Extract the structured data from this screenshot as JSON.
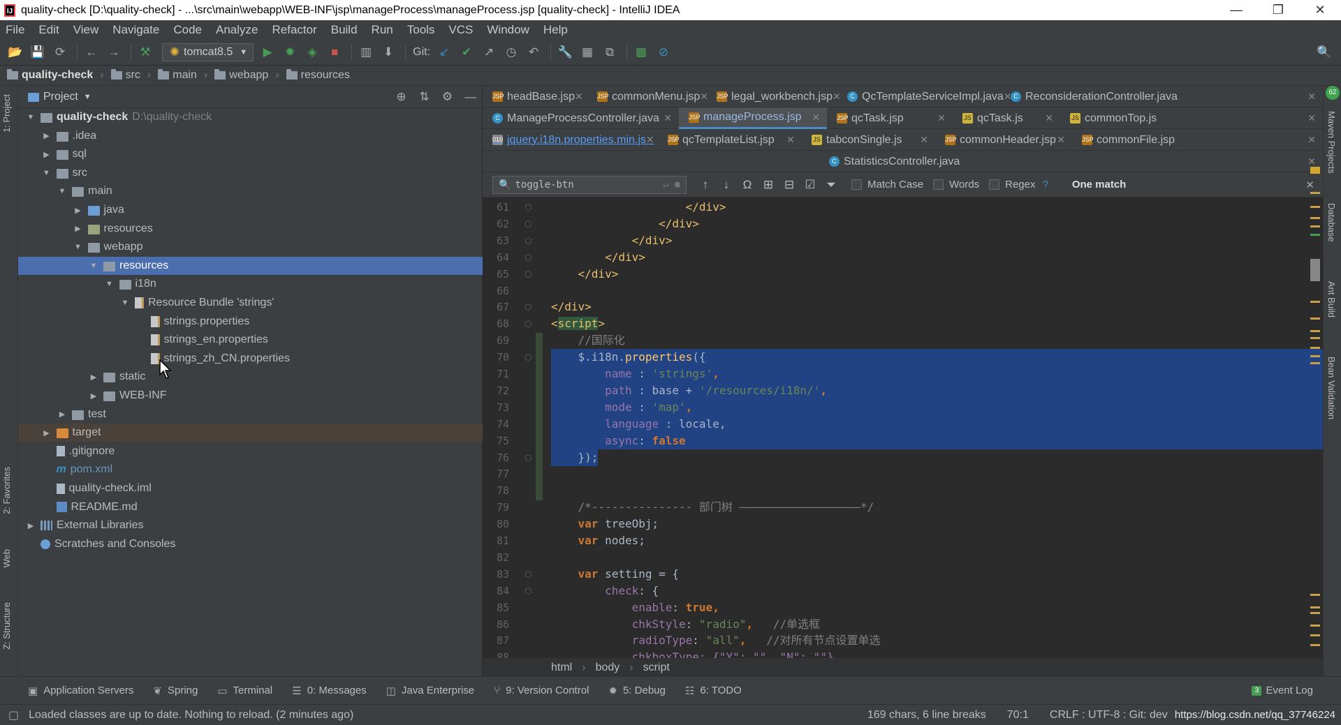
{
  "window": {
    "title": "quality-check [D:\\quality-check] - ...\\src\\main\\webapp\\WEB-INF\\jsp\\manageProcess\\manageProcess.jsp [quality-check] - IntelliJ IDEA",
    "minimize": "—",
    "restore": "❐",
    "close": "✕"
  },
  "menu": [
    "File",
    "Edit",
    "View",
    "Navigate",
    "Code",
    "Analyze",
    "Refactor",
    "Build",
    "Run",
    "Tools",
    "VCS",
    "Window",
    "Help"
  ],
  "toolbar": {
    "run_config": "tomcat8.5",
    "git_label": "Git:"
  },
  "breadcrumb": [
    "quality-check",
    "src",
    "main",
    "webapp",
    "resources"
  ],
  "left_stripe": {
    "project": "1: Project",
    "favorites": "2: Favorites",
    "web": "Web",
    "structure": "Z: Structure"
  },
  "project_panel": {
    "title": "Project",
    "tree": [
      {
        "depth": 0,
        "label": "quality-check",
        "extra": "D:\\quality-check",
        "icon": "folder",
        "open": true,
        "bold": true
      },
      {
        "depth": 1,
        "label": ".idea",
        "icon": "folder",
        "open": false
      },
      {
        "depth": 1,
        "label": "sql",
        "icon": "folder",
        "open": false
      },
      {
        "depth": 1,
        "label": "src",
        "icon": "folder",
        "open": true
      },
      {
        "depth": 2,
        "label": "main",
        "icon": "folder",
        "open": true
      },
      {
        "depth": 3,
        "label": "java",
        "icon": "src",
        "open": false
      },
      {
        "depth": 3,
        "label": "resources",
        "icon": "res",
        "open": false
      },
      {
        "depth": 3,
        "label": "webapp",
        "icon": "folder",
        "open": true
      },
      {
        "depth": 4,
        "label": "resources",
        "icon": "folder",
        "open": true,
        "selected": true
      },
      {
        "depth": 5,
        "label": "i18n",
        "icon": "folder",
        "open": true
      },
      {
        "depth": 6,
        "label": "Resource Bundle 'strings'",
        "icon": "prop",
        "open": true
      },
      {
        "depth": 7,
        "label": "strings.properties",
        "icon": "prop"
      },
      {
        "depth": 7,
        "label": "strings_en.properties",
        "icon": "prop"
      },
      {
        "depth": 7,
        "label": "strings_zh_CN.properties",
        "icon": "prop"
      },
      {
        "depth": 4,
        "label": "static",
        "icon": "folder",
        "open": false
      },
      {
        "depth": 4,
        "label": "WEB-INF",
        "icon": "folder",
        "open": false
      },
      {
        "depth": 2,
        "label": "test",
        "icon": "folder",
        "open": false
      },
      {
        "depth": 1,
        "label": "target",
        "icon": "orange",
        "open": false,
        "target": true
      },
      {
        "depth": 1,
        "label": ".gitignore",
        "icon": "file"
      },
      {
        "depth": 1,
        "label": "pom.xml",
        "icon": "mvn",
        "blue": true
      },
      {
        "depth": 1,
        "label": "quality-check.iml",
        "icon": "file"
      },
      {
        "depth": 1,
        "label": "README.md",
        "icon": "md"
      },
      {
        "depth": 0,
        "label": "External Libraries",
        "icon": "lib",
        "open": false
      },
      {
        "depth": 0,
        "label": "Scratches and Consoles",
        "icon": "scratch"
      }
    ]
  },
  "tabs": {
    "row1": [
      {
        "label": "headBase.jsp",
        "type": "jsp"
      },
      {
        "label": "commonMenu.jsp",
        "type": "jsp"
      },
      {
        "label": "legal_workbench.jsp",
        "type": "jsp"
      },
      {
        "label": "QcTemplateServiceImpl.java",
        "type": "java"
      },
      {
        "label": "ReconsiderationController.java",
        "type": "java"
      }
    ],
    "row2": [
      {
        "label": "ManageProcessController.java",
        "type": "java"
      },
      {
        "label": "manageProcess.jsp",
        "type": "jsp",
        "active": true
      },
      {
        "label": "qcTask.jsp",
        "type": "jsp"
      },
      {
        "label": "qcTask.js",
        "type": "js"
      },
      {
        "label": "commonTop.js",
        "type": "js"
      }
    ],
    "row3": [
      {
        "label": "jquery.i18n.properties.min.js",
        "type": "prop",
        "link": true
      },
      {
        "label": "qcTemplateList.jsp",
        "type": "jsp"
      },
      {
        "label": "tabconSingle.js",
        "type": "js"
      },
      {
        "label": "commonHeader.jsp",
        "type": "jsp"
      },
      {
        "label": "commonFile.jsp",
        "type": "jsp"
      }
    ],
    "row4": [
      {
        "label": "StatisticsController.java",
        "type": "java"
      }
    ]
  },
  "find": {
    "query": "toggle-btn",
    "match_case": "Match Case",
    "words": "Words",
    "regex": "Regex",
    "help": "?",
    "result": "One match"
  },
  "code_lines": [
    61,
    62,
    63,
    64,
    65,
    66,
    67,
    68,
    69,
    70,
    71,
    72,
    73,
    74,
    75,
    76,
    77,
    78,
    79,
    80,
    81,
    82,
    83,
    84,
    85,
    86,
    87,
    88
  ],
  "code_text": {
    "l61": "</div>",
    "l62": "</div>",
    "l63": "</div>",
    "l64": "</div>",
    "l65": "</div>",
    "l67": "</div>",
    "l68_a": "<",
    "l68_b": "script",
    "l68_c": ">",
    "l69": "//国际化",
    "l70_a": "$.i18n.",
    "l70_b": "properties",
    "l70_c": "({",
    "l71_a": "name",
    "l71_b": " : ",
    "l71_c": "'strings'",
    "l71_d": ",",
    "l72_a": "path",
    "l72_b": " : base + ",
    "l72_c": "'/resources/i18n/'",
    "l72_d": ",",
    "l73_a": "mode",
    "l73_b": " : ",
    "l73_c": "'map'",
    "l73_d": ",",
    "l74_a": "language",
    "l74_b": " : locale,",
    "l75_a": "async",
    "l75_b": ": ",
    "l75_c": "false",
    "l76": "});",
    "l79": "/*--------------- 部门树 ——————————————————*/",
    "l80_a": "var",
    "l80_b": " treeObj;",
    "l81_a": "var",
    "l81_b": " nodes;",
    "l83_a": "var",
    "l83_b": " setting = {",
    "l84_a": "check",
    "l84_b": ": {",
    "l85_a": "enable",
    "l85_b": ": ",
    "l85_c": "true",
    "l85_d": ",",
    "l86_a": "chkStyle",
    "l86_b": ": ",
    "l86_c": "\"radio\"",
    "l86_d": ",   ",
    "l86_e": "//单选框",
    "l87_a": "radioType",
    "l87_b": ": ",
    "l87_c": "\"all\"",
    "l87_d": ",   ",
    "l87_e": "//对所有节点设置单选",
    "l88": "chkboxType: {\"Y\": \"\", \"N\": \"\"}"
  },
  "editor_crumbs": [
    "html",
    "body",
    "script"
  ],
  "right_stripe": {
    "maven": "Maven Projects",
    "database": "Database",
    "ant": "Ant Build",
    "bean": "Bean Validation",
    "badge": "62"
  },
  "bottom_tools": [
    {
      "label": "Application Servers",
      "icon": "▣"
    },
    {
      "label": "Spring",
      "icon": "❦"
    },
    {
      "label": "Terminal",
      "icon": "▭"
    },
    {
      "label": "0: Messages",
      "icon": "☰"
    },
    {
      "label": "Java Enterprise",
      "icon": "◫"
    },
    {
      "label": "9: Version Control",
      "icon": "⑂"
    },
    {
      "label": "5: Debug",
      "icon": "✹"
    },
    {
      "label": "6: TODO",
      "icon": "☷"
    }
  ],
  "event_log": {
    "label": "Event Log",
    "count": "3"
  },
  "status": {
    "message": "Loaded classes are up to date. Nothing to reload. (2 minutes ago)",
    "chars": "169 chars, 6 line breaks",
    "position": "70:1",
    "encoding": "CRLF : UTF-8 : Git: dev",
    "watermark": "https://blog.csdn.net/qq_37746224"
  }
}
